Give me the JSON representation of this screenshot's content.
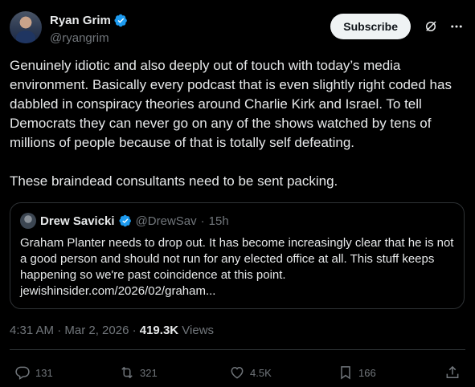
{
  "author": {
    "name": "Ryan Grim",
    "handle": "@ryangrim",
    "subscribe_label": "Subscribe"
  },
  "post": {
    "text": "Genuinely idiotic and also deeply out of touch with today’s media environment. Basically every podcast that is even slightly right coded has dabbled in conspiracy theories around Charlie Kirk and Israel. To tell Democrats they can never go on any of the shows watched by tens of millions of people because of that is totally self defeating.\n\nThese braindead consultants need to be sent packing.",
    "timestamp": "4:31 AM · Mar 2, 2026 · ",
    "views_count": "419.3K",
    "views_label": "Views"
  },
  "quoted_post": {
    "name": "Drew Savicki",
    "handle": "@DrewSav",
    "separator": "·",
    "age": "15h",
    "text": "Graham Planter needs to drop out. It has become increasingly clear that he is not a good person and should not run for any elected office at all. This stuff keeps happening so we're past coincidence at this point.",
    "link": "jewishinsider.com/2026/02/graham..."
  },
  "actions": {
    "replies": "131",
    "reposts": "321",
    "likes": "4.5K",
    "bookmarks": "166"
  },
  "colors": {
    "background": "#000000",
    "text": "#e7e9ea",
    "muted": "#71767b",
    "border": "#2f3336",
    "verified": "#1d9bf0"
  }
}
